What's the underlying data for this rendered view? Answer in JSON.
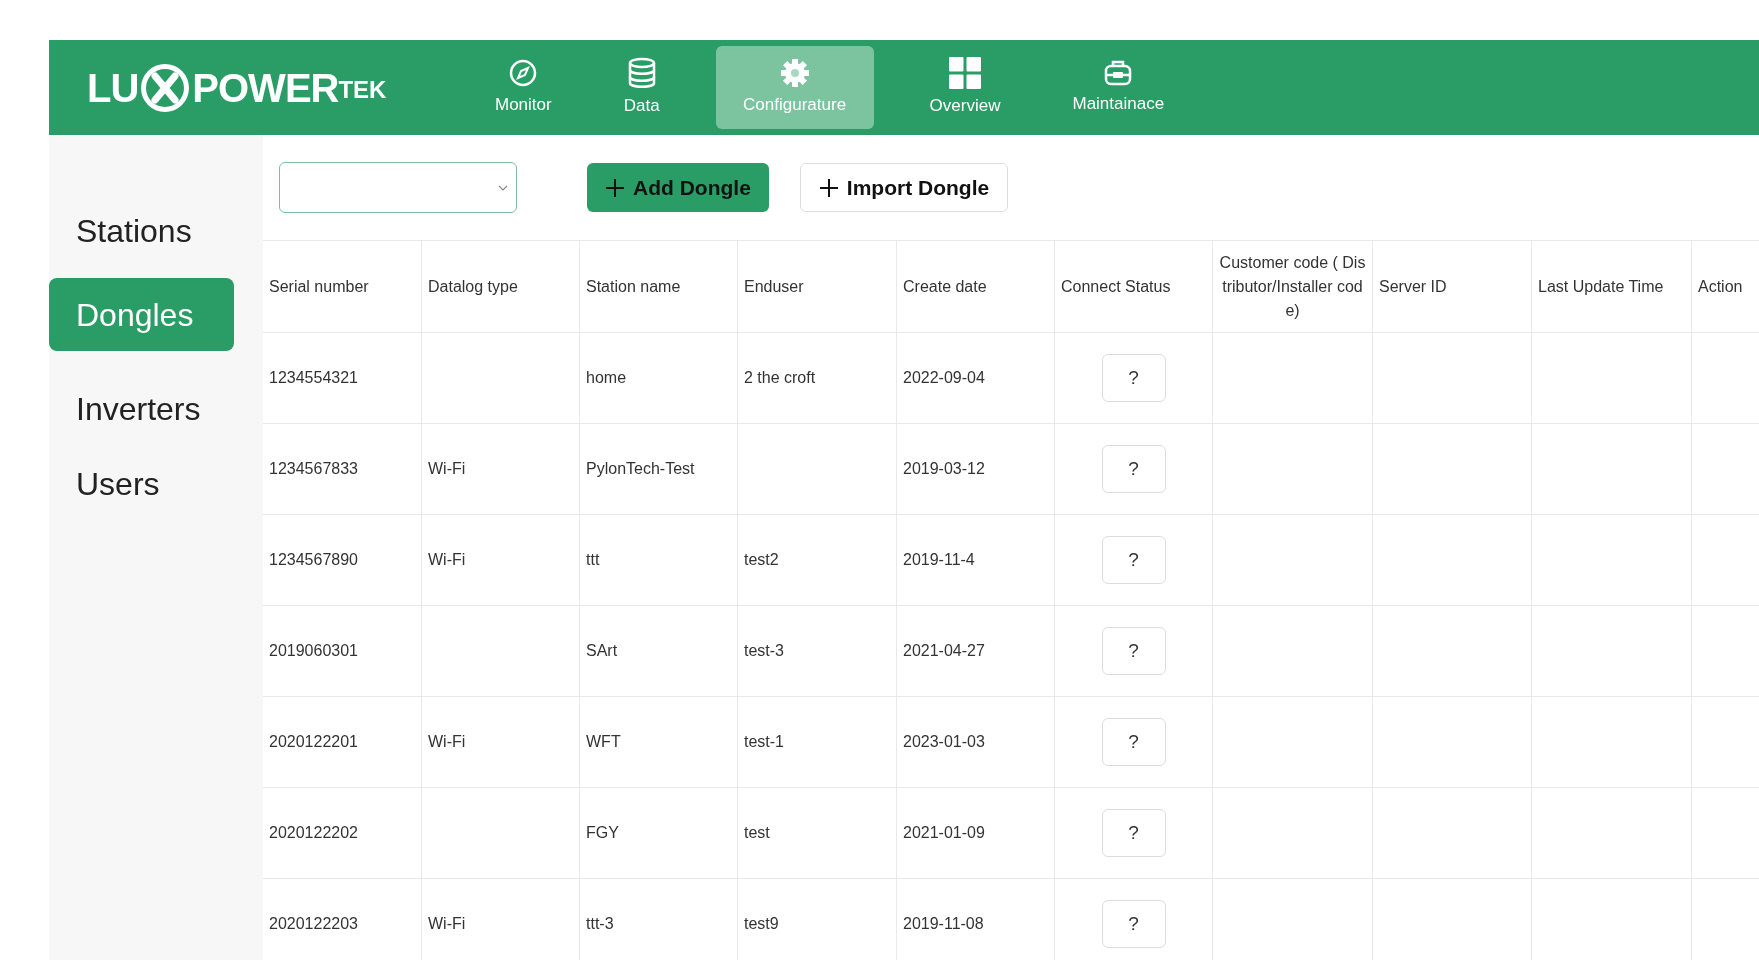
{
  "logo": {
    "left": "LU",
    "right": "POWER",
    "sup": "TEK"
  },
  "nav": [
    {
      "label": "Monitor",
      "kind": "compass",
      "selected": false
    },
    {
      "label": "Data",
      "kind": "database",
      "selected": false
    },
    {
      "label": "Configurature",
      "kind": "gear",
      "selected": true
    },
    {
      "label": "Overview",
      "kind": "grid",
      "selected": false
    },
    {
      "label": "Maintainace",
      "kind": "toolbox",
      "selected": false
    }
  ],
  "sidebar": {
    "items": [
      {
        "label": "Stations",
        "selected": false
      },
      {
        "label": "Dongles",
        "selected": true
      },
      {
        "label": "Inverters",
        "selected": false
      },
      {
        "label": "Users",
        "selected": false
      }
    ]
  },
  "toolbar": {
    "add_button": "Add Dongle",
    "import_button": "Import Dongle"
  },
  "table": {
    "columns": [
      "Serial number",
      "Datalog type",
      "Station name",
      "Enduser",
      "Create date",
      "Connect Status",
      "Customer code ( Distributor/Installer code)",
      "Server ID",
      "Last Update Time",
      "Action"
    ],
    "rows": [
      [
        "1234554321",
        "",
        "home",
        "2 the croft",
        "2022-09-04",
        "?"
      ],
      [
        "1234567833",
        "Wi-Fi",
        "PylonTech-Test",
        "",
        "2019-03-12",
        "?"
      ],
      [
        "1234567890",
        "Wi-Fi",
        "ttt",
        "test2",
        "2019-11-4",
        "?"
      ],
      [
        "2019060301",
        "",
        "SArt",
        "test-3",
        "2021-04-27",
        "?"
      ],
      [
        "2020122201",
        "Wi-Fi",
        "WFT",
        "test-1",
        "2023-01-03",
        "?"
      ],
      [
        "2020122202",
        "",
        "FGY",
        "test",
        "2021-01-09",
        "?"
      ],
      [
        "2020122203",
        "Wi-Fi",
        "ttt-3",
        "test9",
        "2019-11-08",
        "?"
      ]
    ]
  }
}
